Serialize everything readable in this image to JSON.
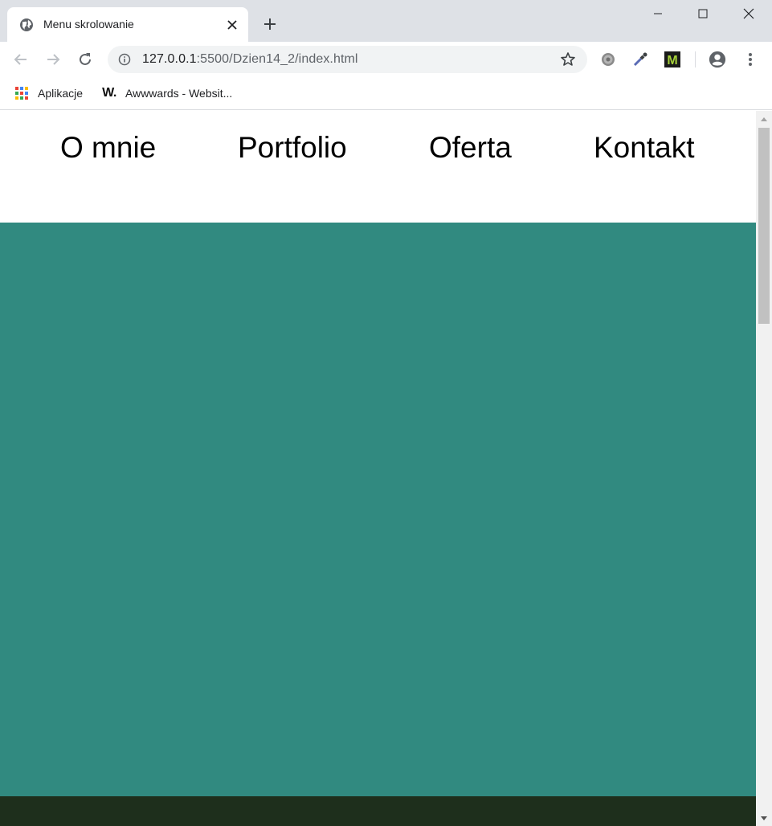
{
  "browser": {
    "tab": {
      "title": "Menu skrolowanie",
      "favicon": "globe-icon"
    },
    "window_controls": [
      "minimize-icon",
      "maximize-icon",
      "close-icon"
    ],
    "address_bar": {
      "host": "127.0.0.1",
      "rest": ":5500/Dzien14_2/index.html"
    },
    "extensions": [
      "gear-extension-icon",
      "color-picker-extension-icon",
      "m-extension-icon",
      "profile-icon",
      "menu-icon"
    ],
    "bookmarks": [
      {
        "label": "Aplikacje",
        "icon": "apps-grid-icon"
      },
      {
        "label": "Awwwards - Websit...",
        "icon": "awwwards-logo-icon",
        "logo_text": "W."
      }
    ]
  },
  "page": {
    "nav": [
      "O mnie",
      "Portfolio",
      "Oferta",
      "Kontakt"
    ],
    "colors": {
      "section_teal": "#318a80",
      "section_dark": "#1e2f1c",
      "nav_background": "#ffffff",
      "nav_text": "#000000"
    }
  }
}
